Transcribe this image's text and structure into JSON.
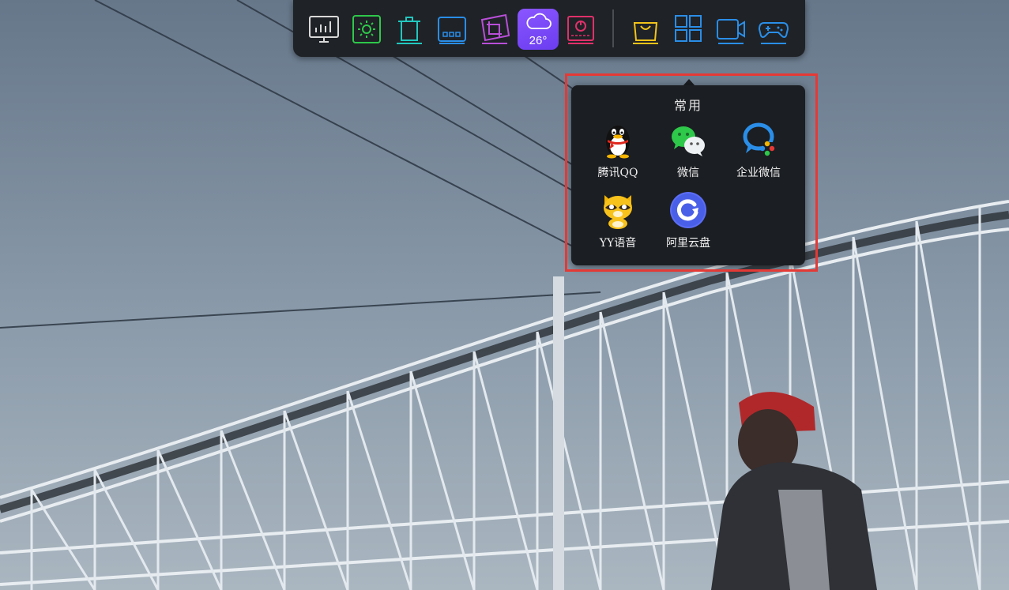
{
  "dock": {
    "items": [
      {
        "name": "monitor",
        "icon": "monitor-chart-icon",
        "color": "#d9d9d9"
      },
      {
        "name": "settings",
        "icon": "gear-icon",
        "color": "#2ec84a"
      },
      {
        "name": "trash",
        "icon": "trash-icon",
        "color": "#22c7c0"
      },
      {
        "name": "storage",
        "icon": "drive-icon",
        "color": "#2a8ee8"
      },
      {
        "name": "screenshot",
        "icon": "crop-icon",
        "color": "#b84fd8"
      },
      {
        "name": "weather",
        "icon": "cloud-icon",
        "color": "#7a4cff"
      },
      {
        "name": "power",
        "icon": "power-icon",
        "color": "#e0306a"
      },
      {
        "name": "shopping",
        "icon": "shopping-bag-icon",
        "color": "#f2c31a"
      },
      {
        "name": "apps",
        "icon": "grid-icon",
        "color": "#2a8ee8"
      },
      {
        "name": "video",
        "icon": "video-camera-icon",
        "color": "#2a8ee8"
      },
      {
        "name": "games",
        "icon": "gamepad-icon",
        "color": "#2a8ee8"
      }
    ],
    "weather_temp": "26°"
  },
  "popup": {
    "title": "常用",
    "apps": [
      {
        "label": "腾讯QQ",
        "icon": "qq-penguin-icon"
      },
      {
        "label": "微信",
        "icon": "wechat-icon"
      },
      {
        "label": "企业微信",
        "icon": "wecom-icon"
      },
      {
        "label": "YY语音",
        "icon": "yy-raccoon-icon"
      },
      {
        "label": "阿里云盘",
        "icon": "aliyun-drive-icon"
      }
    ],
    "highlight_color": "#e53935"
  }
}
